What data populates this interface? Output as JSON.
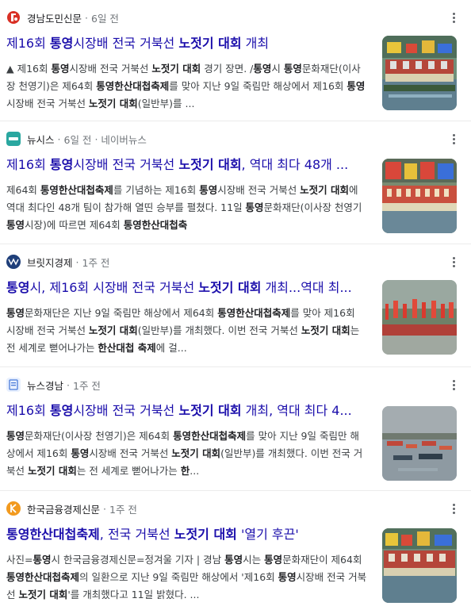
{
  "articles": [
    {
      "source": "경남도민신문",
      "time": "6일 전",
      "portal": "",
      "title_parts": [
        {
          "t": "제16회 ",
          "b": false
        },
        {
          "t": "통영",
          "b": true
        },
        {
          "t": "시장배 전국 거북선 ",
          "b": false
        },
        {
          "t": "노젓기 대회",
          "b": true
        },
        {
          "t": " 개최",
          "b": false
        }
      ],
      "snippet_parts": [
        {
          "t": "▲ 제16회 ",
          "b": false
        },
        {
          "t": "통영",
          "b": true
        },
        {
          "t": "시장배 전국 거북선 ",
          "b": false
        },
        {
          "t": "노젓기 대회",
          "b": true
        },
        {
          "t": " 경기 장면. /",
          "b": false
        },
        {
          "t": "통영",
          "b": true
        },
        {
          "t": "시 ",
          "b": false
        },
        {
          "t": "통영",
          "b": true
        },
        {
          "t": "문화재단(이사장 천영기)은 제64회 ",
          "b": false
        },
        {
          "t": "통영한산대첩축제",
          "b": true
        },
        {
          "t": "를 맞아 지난 9일 죽림만 해상에서 제16회 ",
          "b": false
        },
        {
          "t": "통영",
          "b": true
        },
        {
          "t": "시장배 전국 거북선 ",
          "b": false
        },
        {
          "t": "노젓기 대회",
          "b": true
        },
        {
          "t": "(일반부)를 ...",
          "b": false
        }
      ]
    },
    {
      "source": "뉴시스",
      "time": "6일 전",
      "portal": "네이버뉴스",
      "title_parts": [
        {
          "t": "제16회 ",
          "b": false
        },
        {
          "t": "통영",
          "b": true
        },
        {
          "t": "시장배 전국 거북선 ",
          "b": false
        },
        {
          "t": "노젓기 대회",
          "b": true
        },
        {
          "t": ", 역대 최다 48개 ...",
          "b": false
        }
      ],
      "snippet_parts": [
        {
          "t": "제64회 ",
          "b": false
        },
        {
          "t": "통영한산대첩축제",
          "b": true
        },
        {
          "t": "를 기념하는 제16회 ",
          "b": false
        },
        {
          "t": "통영",
          "b": true
        },
        {
          "t": "시장배 전국 거북선 ",
          "b": false
        },
        {
          "t": "노젓기 대회",
          "b": true
        },
        {
          "t": "에 역대 최다인 48개 팀이 참가해 열띤 승부를 펼쳤다. 11일 ",
          "b": false
        },
        {
          "t": "통영",
          "b": true
        },
        {
          "t": "문화재단(이사장 천영기 ",
          "b": false
        },
        {
          "t": "통영",
          "b": true
        },
        {
          "t": "시장)에 따르면 제64회 ",
          "b": false
        },
        {
          "t": "통영한산대첩축",
          "b": true
        }
      ]
    },
    {
      "source": "브릿지경제",
      "time": "1주 전",
      "portal": "",
      "title_parts": [
        {
          "t": "통영",
          "b": true
        },
        {
          "t": "시, 제16회 시장배 전국 거북선 ",
          "b": false
        },
        {
          "t": "노젓기 대회",
          "b": true
        },
        {
          "t": " 개최...역대 최...",
          "b": false
        }
      ],
      "snippet_parts": [
        {
          "t": "통영",
          "b": true
        },
        {
          "t": "문화재단은 지난 9일 죽림만 해상에서 제64회 ",
          "b": false
        },
        {
          "t": "통영한산대첩축제",
          "b": true
        },
        {
          "t": "를 맞아 제16회 시장배 전국 거북선 ",
          "b": false
        },
        {
          "t": "노젓기 대회",
          "b": true
        },
        {
          "t": "(일반부)를 개최했다. 이번 전국 거북선 ",
          "b": false
        },
        {
          "t": "노젓기 대회",
          "b": true
        },
        {
          "t": "는 전 세계로 뻗어나가는 ",
          "b": false
        },
        {
          "t": "한산대첩 축제",
          "b": true
        },
        {
          "t": "에 걸...",
          "b": false
        }
      ]
    },
    {
      "source": "뉴스경남",
      "time": "1주 전",
      "portal": "",
      "title_parts": [
        {
          "t": "제16회 ",
          "b": false
        },
        {
          "t": "통영",
          "b": true
        },
        {
          "t": "시장배 전국 거북선 ",
          "b": false
        },
        {
          "t": "노젓기 대회",
          "b": true
        },
        {
          "t": " 개최, 역대 최다 4...",
          "b": false
        }
      ],
      "snippet_parts": [
        {
          "t": "통영",
          "b": true
        },
        {
          "t": "문화재단(이사장 천영기)은 제64회 ",
          "b": false
        },
        {
          "t": "통영한산대첩축제",
          "b": true
        },
        {
          "t": "를 맞아 지난 9일 죽림만 해상에서 제16회 ",
          "b": false
        },
        {
          "t": "통영",
          "b": true
        },
        {
          "t": "시장배 전국 거북선 ",
          "b": false
        },
        {
          "t": "노젓기 대회",
          "b": true
        },
        {
          "t": "(일반부)를 개최했다. 이번 전국 거북선 ",
          "b": false
        },
        {
          "t": "노젓기 대회",
          "b": true
        },
        {
          "t": "는 전 세계로 뻗어나가는 ",
          "b": false
        },
        {
          "t": "한",
          "b": true
        },
        {
          "t": "...",
          "b": false
        }
      ]
    },
    {
      "source": "한국금융경제신문",
      "time": "1주 전",
      "portal": "",
      "title_parts": [
        {
          "t": "통영한산대첩축제",
          "b": true
        },
        {
          "t": ", 전국 거북선 ",
          "b": false
        },
        {
          "t": "노젓기 대회",
          "b": true
        },
        {
          "t": " '열기 후끈'",
          "b": false
        }
      ],
      "snippet_parts": [
        {
          "t": "사진=",
          "b": false
        },
        {
          "t": "통영",
          "b": true
        },
        {
          "t": "시 한국금융경제신문=정겨울 기자 | 경남 ",
          "b": false
        },
        {
          "t": "통영",
          "b": true
        },
        {
          "t": "시는 ",
          "b": false
        },
        {
          "t": "통영",
          "b": true
        },
        {
          "t": "문화재단이 제64회 ",
          "b": false
        },
        {
          "t": "통영한산대첩축제",
          "b": true
        },
        {
          "t": "의 일환으로 지난 9일 죽림만 해상에서 '제16회 ",
          "b": false
        },
        {
          "t": "통영",
          "b": true
        },
        {
          "t": "시장배 전국 거북선 ",
          "b": false
        },
        {
          "t": "노젓기 대회",
          "b": true
        },
        {
          "t": "'를 개최했다고 11일 밝혔다. ...",
          "b": false
        }
      ]
    }
  ],
  "colors": {
    "title_link": "#1a0dab",
    "meta": "#70757a",
    "snippet": "#3c4043",
    "divider": "#ebebeb"
  },
  "icons": [
    "gyeongnam-domin-logo",
    "newsis-logo",
    "viva-logo",
    "news-gyeongnam-logo",
    "kfenews-logo",
    "more-vert-icon"
  ]
}
